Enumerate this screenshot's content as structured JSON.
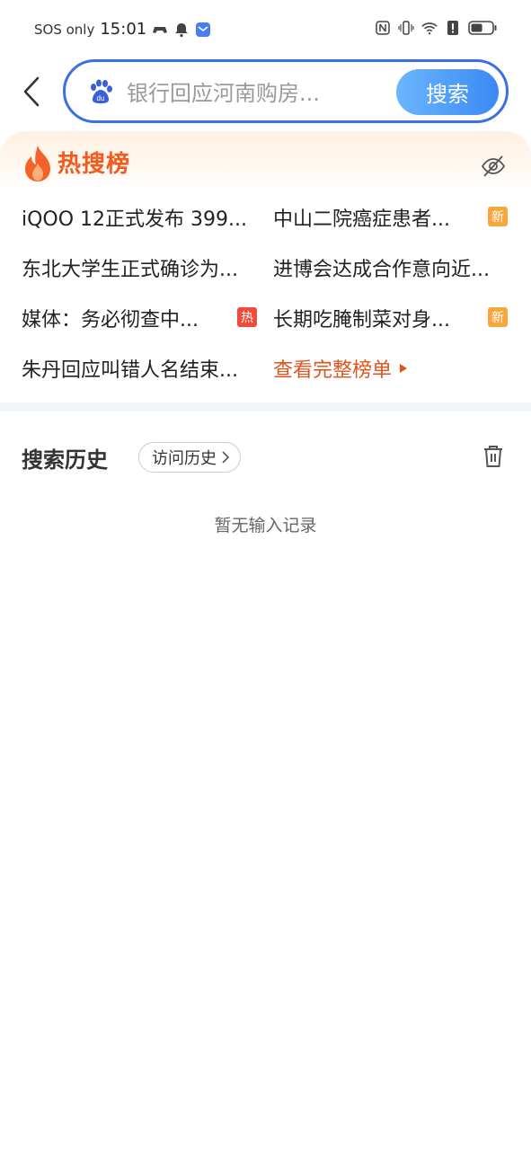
{
  "status_bar": {
    "carrier": "SOS only",
    "time": "15:01",
    "battery_level": 0.55
  },
  "search": {
    "placeholder": "银行回应河南购房...",
    "button_label": "搜索"
  },
  "hot_list": {
    "title": "热搜榜",
    "items": [
      {
        "text": "iQOO 12正式发布 399...",
        "tag": ""
      },
      {
        "text": "中山二院癌症患者...",
        "tag": "新"
      },
      {
        "text": "东北大学生正式确诊为...",
        "tag": ""
      },
      {
        "text": "进博会达成合作意向近...",
        "tag": ""
      },
      {
        "text": "媒体：务必彻查中...",
        "tag": "热"
      },
      {
        "text": "长期吃腌制菜对身...",
        "tag": "新"
      },
      {
        "text": "朱丹回应叫错人名结束...",
        "tag": ""
      }
    ],
    "view_all": "查看完整榜单"
  },
  "history": {
    "title": "搜索历史",
    "visit_history": "访问历史",
    "empty": "暂无输入记录"
  },
  "colors": {
    "accent_blue": "#3a6fe6",
    "hot_orange": "#f25a1e",
    "tag_new": "#f7a73c",
    "tag_hot": "#f04a3a"
  }
}
